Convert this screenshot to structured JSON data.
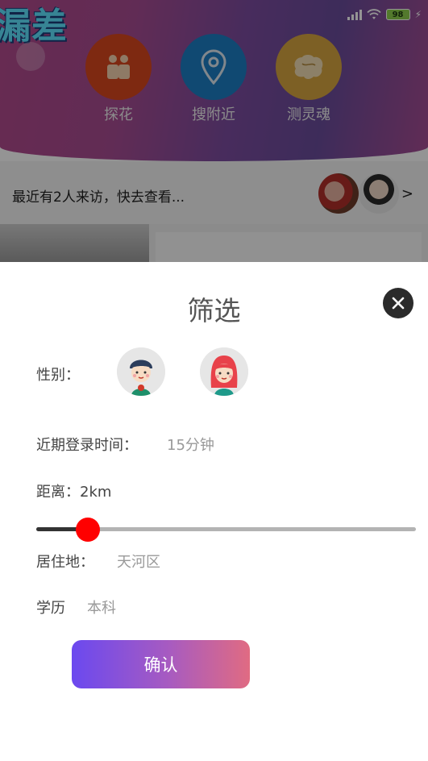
{
  "background": {
    "logo_text": "漏差",
    "status": {
      "battery": "98"
    },
    "quick_actions": [
      {
        "label": "探花",
        "icon": "people-icon",
        "color": "#d9471e"
      },
      {
        "label": "搜附近",
        "icon": "location-pin-icon",
        "color": "#1c7fc4"
      },
      {
        "label": "测灵魂",
        "icon": "brain-icon",
        "color": "#d8a640"
      }
    ],
    "visitors": {
      "text": "最近有2人来访，快去查看...",
      "chevron": ">"
    }
  },
  "filter": {
    "title": "筛选",
    "close_icon": "close-icon",
    "gender": {
      "label": "性别：",
      "options": [
        "male-avatar-icon",
        "female-avatar-icon"
      ]
    },
    "login_time": {
      "label": "近期登录时间：",
      "value": "15分钟"
    },
    "distance": {
      "label": "距离：2km",
      "slider_fraction": 0.135
    },
    "residence": {
      "label": "居住地：",
      "value": "天河区"
    },
    "education": {
      "label": "学历",
      "value": "本科"
    },
    "confirm_label": "确认"
  },
  "colors": {
    "accent_start": "#6b49ef",
    "accent_end": "#e06b82",
    "slider_thumb": "#ff0000"
  }
}
